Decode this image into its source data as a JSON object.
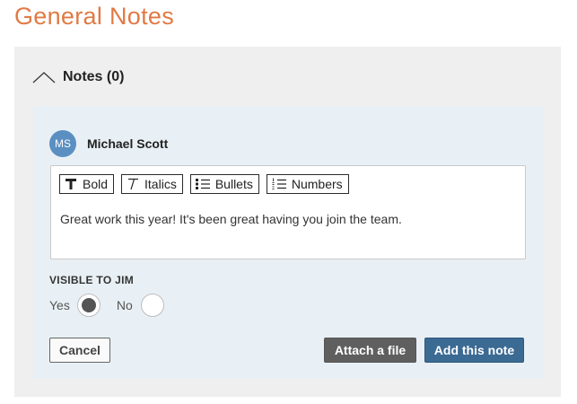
{
  "page": {
    "title": "General Notes"
  },
  "notes": {
    "header_label": "Notes (0)",
    "author": {
      "initials": "MS",
      "name": "Michael Scott"
    },
    "toolbar": {
      "bold": "Bold",
      "italics": "Italics",
      "bullets": "Bullets",
      "numbers": "Numbers"
    },
    "editor_text": "Great work this year! It's been great having you join the team.",
    "visibility": {
      "label": "VISIBLE TO JIM",
      "yes": "Yes",
      "no": "No",
      "selected": "Yes"
    },
    "buttons": {
      "cancel": "Cancel",
      "attach": "Attach a file",
      "add": "Add this note"
    }
  },
  "colors": {
    "title": "#e07a45",
    "avatar": "#5b8fc2",
    "add_button": "#3b6a93",
    "attach_button": "#5f5f5f"
  },
  "icons": [
    "chevron-up-icon",
    "bold-icon",
    "italic-icon",
    "bullet-list-icon",
    "numbered-list-icon"
  ]
}
